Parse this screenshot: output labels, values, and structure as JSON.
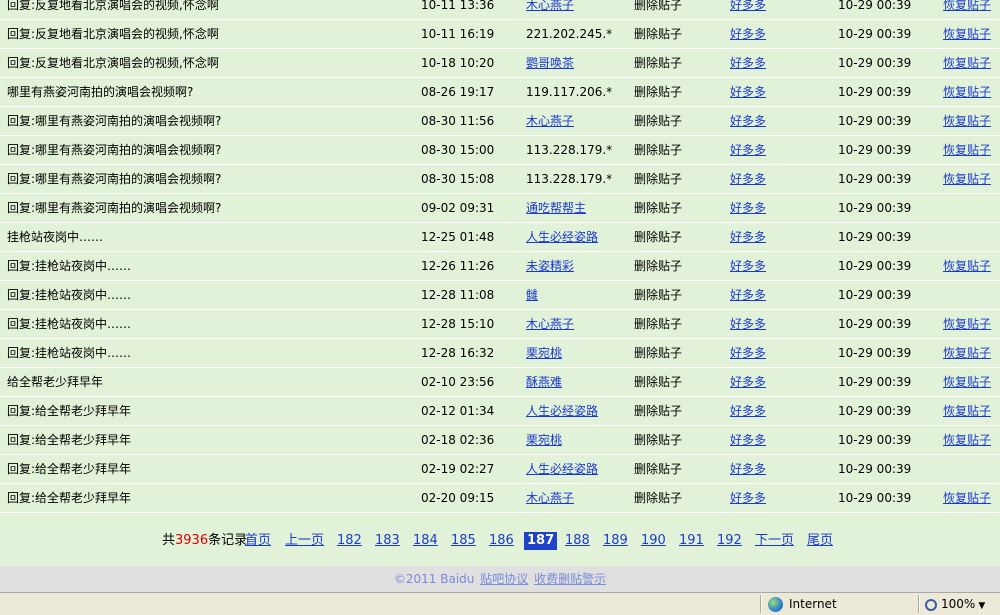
{
  "rows": [
    {
      "title": "回复:反复地看北京演唱会的视频,怀念啊",
      "time": "10-11 13:36",
      "author": "木心燕子",
      "author_link": true,
      "action": "删除贴子",
      "operator": "好多多",
      "op_time": "10-29 00:39",
      "restore": "恢复贴子"
    },
    {
      "title": "回复:反复地看北京演唱会的视频,怀念啊",
      "time": "10-11 16:19",
      "author": "221.202.245.*",
      "author_link": false,
      "action": "删除贴子",
      "operator": "好多多",
      "op_time": "10-29 00:39",
      "restore": "恢复贴子"
    },
    {
      "title": "回复:反复地看北京演唱会的视频,怀念啊",
      "time": "10-18 10:20",
      "author": "鹦哥唤茶",
      "author_link": true,
      "action": "删除贴子",
      "operator": "好多多",
      "op_time": "10-29 00:39",
      "restore": "恢复贴子"
    },
    {
      "title": "哪里有燕姿河南拍的演唱会视频啊?",
      "time": "08-26 19:17",
      "author": "119.117.206.*",
      "author_link": false,
      "action": "删除贴子",
      "operator": "好多多",
      "op_time": "10-29 00:39",
      "restore": "恢复贴子"
    },
    {
      "title": "回复:哪里有燕姿河南拍的演唱会视频啊?",
      "time": "08-30 11:56",
      "author": "木心燕子",
      "author_link": true,
      "action": "删除贴子",
      "operator": "好多多",
      "op_time": "10-29 00:39",
      "restore": "恢复贴子"
    },
    {
      "title": "回复:哪里有燕姿河南拍的演唱会视频啊?",
      "time": "08-30 15:00",
      "author": "113.228.179.*",
      "author_link": false,
      "action": "删除贴子",
      "operator": "好多多",
      "op_time": "10-29 00:39",
      "restore": "恢复贴子"
    },
    {
      "title": "回复:哪里有燕姿河南拍的演唱会视频啊?",
      "time": "08-30 15:08",
      "author": "113.228.179.*",
      "author_link": false,
      "action": "删除贴子",
      "operator": "好多多",
      "op_time": "10-29 00:39",
      "restore": "恢复贴子"
    },
    {
      "title": "回复:哪里有燕姿河南拍的演唱会视频啊?",
      "time": "09-02 09:31",
      "author": "通吃帮帮主",
      "author_link": true,
      "action": "删除贴子",
      "operator": "好多多",
      "op_time": "10-29 00:39",
      "restore": ""
    },
    {
      "title": "挂枪站夜岗中……",
      "time": "12-25 01:48",
      "author": "人生必经姿路",
      "author_link": true,
      "action": "删除贴子",
      "operator": "好多多",
      "op_time": "10-29 00:39",
      "restore": ""
    },
    {
      "title": "回复:挂枪站夜岗中……",
      "time": "12-26 11:26",
      "author": "未姿精彩",
      "author_link": true,
      "action": "删除贴子",
      "operator": "好多多",
      "op_time": "10-29 00:39",
      "restore": "恢复贴子"
    },
    {
      "title": "回复:挂枪站夜岗中……",
      "time": "12-28 11:08",
      "author": "雠",
      "author_link": true,
      "action": "删除贴子",
      "operator": "好多多",
      "op_time": "10-29 00:39",
      "restore": ""
    },
    {
      "title": "回复:挂枪站夜岗中……",
      "time": "12-28 15:10",
      "author": "木心燕子",
      "author_link": true,
      "action": "删除贴子",
      "operator": "好多多",
      "op_time": "10-29 00:39",
      "restore": "恢复贴子"
    },
    {
      "title": "回复:挂枪站夜岗中……",
      "time": "12-28 16:32",
      "author": "栗宛桃",
      "author_link": true,
      "action": "删除贴子",
      "operator": "好多多",
      "op_time": "10-29 00:39",
      "restore": "恢复贴子"
    },
    {
      "title": "给全帮老少拜早年",
      "time": "02-10 23:56",
      "author": "酥燕难",
      "author_link": true,
      "action": "删除贴子",
      "operator": "好多多",
      "op_time": "10-29 00:39",
      "restore": "恢复贴子"
    },
    {
      "title": "回复:给全帮老少拜早年",
      "time": "02-12 01:34",
      "author": "人生必经姿路",
      "author_link": true,
      "action": "删除贴子",
      "operator": "好多多",
      "op_time": "10-29 00:39",
      "restore": "恢复贴子"
    },
    {
      "title": "回复:给全帮老少拜早年",
      "time": "02-18 02:36",
      "author": "栗宛桃",
      "author_link": true,
      "action": "删除贴子",
      "operator": "好多多",
      "op_time": "10-29 00:39",
      "restore": "恢复贴子"
    },
    {
      "title": "回复:给全帮老少拜早年",
      "time": "02-19 02:27",
      "author": "人生必经姿路",
      "author_link": true,
      "action": "删除贴子",
      "operator": "好多多",
      "op_time": "10-29 00:39",
      "restore": ""
    },
    {
      "title": "回复:给全帮老少拜早年",
      "time": "02-20 09:15",
      "author": "木心燕子",
      "author_link": true,
      "action": "删除贴子",
      "operator": "好多多",
      "op_time": "10-29 00:39",
      "restore": "恢复贴子"
    }
  ],
  "pager": {
    "count_prefix": "共",
    "count_num": "3936",
    "count_suffix": "条记录",
    "first": "首页",
    "prev": "上一页",
    "pages": [
      "182",
      "183",
      "184",
      "185",
      "186",
      "187",
      "188",
      "189",
      "190",
      "191",
      "192"
    ],
    "current": "187",
    "next": "下一页",
    "last": "尾页"
  },
  "footer": {
    "copyright": "©2011 Baidu",
    "agreement": "贴吧协议",
    "paid_delete": "收费删贴警示"
  },
  "statusbar": {
    "zone": "Internet",
    "zoom": "100%"
  }
}
